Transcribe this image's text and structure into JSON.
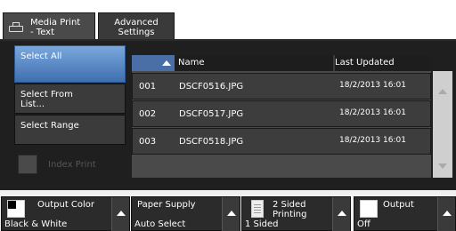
{
  "tabs": [
    {
      "label": "Media Print\n- Text",
      "active": true
    },
    {
      "label": "Advanced\nSettings",
      "active": false
    }
  ],
  "left_buttons": {
    "select_all": "Select All",
    "select_from_list": "Select From\nList...",
    "select_range": "Select Range",
    "index_print": "Index Print"
  },
  "list": {
    "header": {
      "name": "Name",
      "last_updated": "Last Updated"
    },
    "rows": [
      {
        "no": "001",
        "name": "DSCF0516.JPG",
        "date": "18/2/2013 16:01"
      },
      {
        "no": "002",
        "name": "DSCF0517.JPG",
        "date": "18/2/2013 16:01"
      },
      {
        "no": "003",
        "name": "DSCF0518.JPG",
        "date": "18/2/2013 16:01"
      }
    ]
  },
  "features": {
    "output_color": {
      "title": "Output Color",
      "value": "Black & White"
    },
    "paper_supply": {
      "title": "Paper Supply",
      "value": "Auto Select"
    },
    "two_sided": {
      "title": "2 Sided\nPrinting",
      "value": "1 Sided"
    },
    "output": {
      "title": "Output",
      "value": "Off"
    }
  },
  "colors": {
    "selected_accent": "#5b8fd0",
    "sort_header": "#4a6fa6"
  }
}
